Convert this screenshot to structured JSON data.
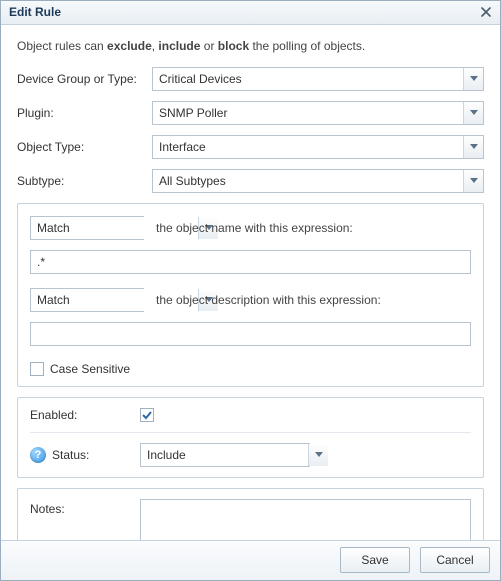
{
  "dialog": {
    "title": "Edit Rule",
    "intro_pre": "Object rules can ",
    "intro_b1": "exclude",
    "intro_sep1": ", ",
    "intro_b2": "include",
    "intro_sep2": " or ",
    "intro_b3": "block",
    "intro_post": " the polling of objects."
  },
  "fields": {
    "deviceGroup": {
      "label": "Device Group or Type:",
      "value": "Critical Devices"
    },
    "plugin": {
      "label": "Plugin:",
      "value": "SNMP Poller"
    },
    "objectType": {
      "label": "Object Type:",
      "value": "Interface"
    },
    "subtype": {
      "label": "Subtype:",
      "value": "All Subtypes"
    }
  },
  "matchPanel": {
    "nameMatchMode": "Match",
    "nameMatchLabel": "the object name with this expression:",
    "nameExpression": ".*",
    "descMatchMode": "Match",
    "descMatchLabel": "the object description with this expression:",
    "descExpression": "",
    "caseSensitiveLabel": "Case Sensitive"
  },
  "enabled": {
    "label": "Enabled:",
    "statusLabel": "Status:",
    "statusValue": "Include"
  },
  "notes": {
    "label": "Notes:",
    "value": ""
  },
  "footer": {
    "save": "Save",
    "cancel": "Cancel"
  },
  "icons": {
    "help": "?"
  }
}
